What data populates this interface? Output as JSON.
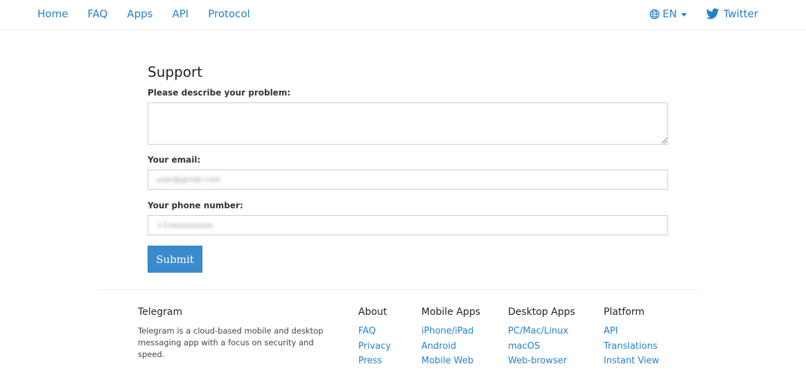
{
  "nav": {
    "links": [
      "Home",
      "FAQ",
      "Apps",
      "API",
      "Protocol"
    ],
    "language": "EN",
    "twitter": "Twitter"
  },
  "form": {
    "title": "Support",
    "problem_label": "Please describe your problem:",
    "problem_value": "",
    "email_label": "Your email:",
    "email_value": "user@gmail.com",
    "phone_label": "Your phone number:",
    "phone_value": "+1xxxxxxxxxx",
    "submit_label": "Submit"
  },
  "footer": {
    "about_title": "Telegram",
    "about_text": "Telegram is a cloud-based mobile and desktop messaging app with a focus on security and speed.",
    "columns": [
      {
        "title": "About",
        "links": [
          "FAQ",
          "Privacy",
          "Press"
        ]
      },
      {
        "title": "Mobile Apps",
        "links": [
          "iPhone/iPad",
          "Android",
          "Mobile Web"
        ]
      },
      {
        "title": "Desktop Apps",
        "links": [
          "PC/Mac/Linux",
          "macOS",
          "Web-browser"
        ]
      },
      {
        "title": "Platform",
        "links": [
          "API",
          "Translations",
          "Instant View"
        ]
      }
    ]
  },
  "colors": {
    "link": "#2481cc",
    "button": "#3a8bcd"
  },
  "icons": {
    "language": "globe-icon",
    "twitter": "twitter-bird-icon",
    "dropdown": "caret-down-icon"
  }
}
